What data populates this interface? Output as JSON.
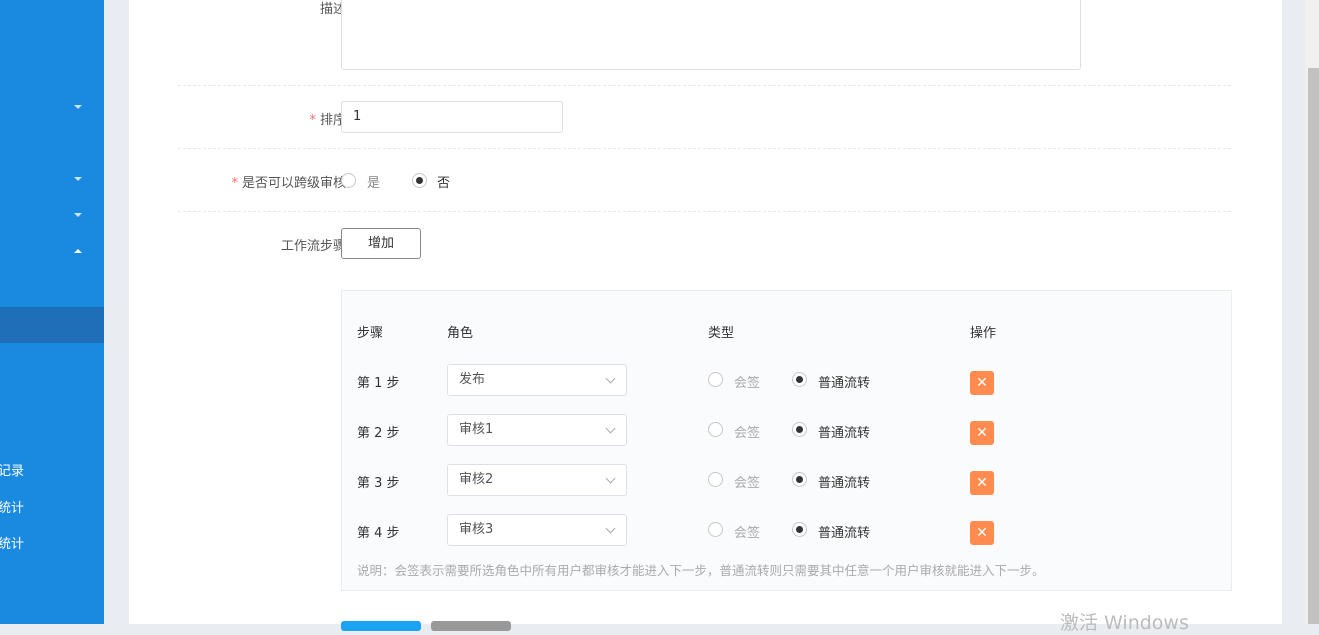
{
  "sidebar": {
    "items": [
      "记录",
      "统计",
      "统计"
    ]
  },
  "form": {
    "desc_label": "描述",
    "sort_label": "排序",
    "sort_value": "1",
    "cross_label": "是否可以跨级审核",
    "cross_yes": "是",
    "cross_no": "否",
    "cross_selected": "否",
    "workflow_label": "工作流步骤",
    "add_button": "增加"
  },
  "table": {
    "headers": [
      "步骤",
      "角色",
      "类型",
      "操作"
    ],
    "rows": [
      {
        "step": "第 1 步",
        "role": "发布",
        "opt1": "会签",
        "opt2": "普通流转",
        "selected": "普通流转"
      },
      {
        "step": "第 2 步",
        "role": "审核1",
        "opt1": "会签",
        "opt2": "普通流转",
        "selected": "普通流转"
      },
      {
        "step": "第 3 步",
        "role": "审核2",
        "opt1": "会签",
        "opt2": "普通流转",
        "selected": "普通流转"
      },
      {
        "step": "第 4 步",
        "role": "审核3",
        "opt1": "会签",
        "opt2": "普通流转",
        "selected": "普通流转"
      }
    ],
    "delete_icon": "✕",
    "note": "说明：会签表示需要所选角色中所有用户都审核才能进入下一步，普通流转则只需要其中任意一个用户审核就能进入下一步。"
  },
  "watermark": "激活 Windows",
  "colors": {
    "sidebar": "#1a8ae0",
    "delete": "#ff8c4e",
    "primary": "#1aa3f0"
  }
}
